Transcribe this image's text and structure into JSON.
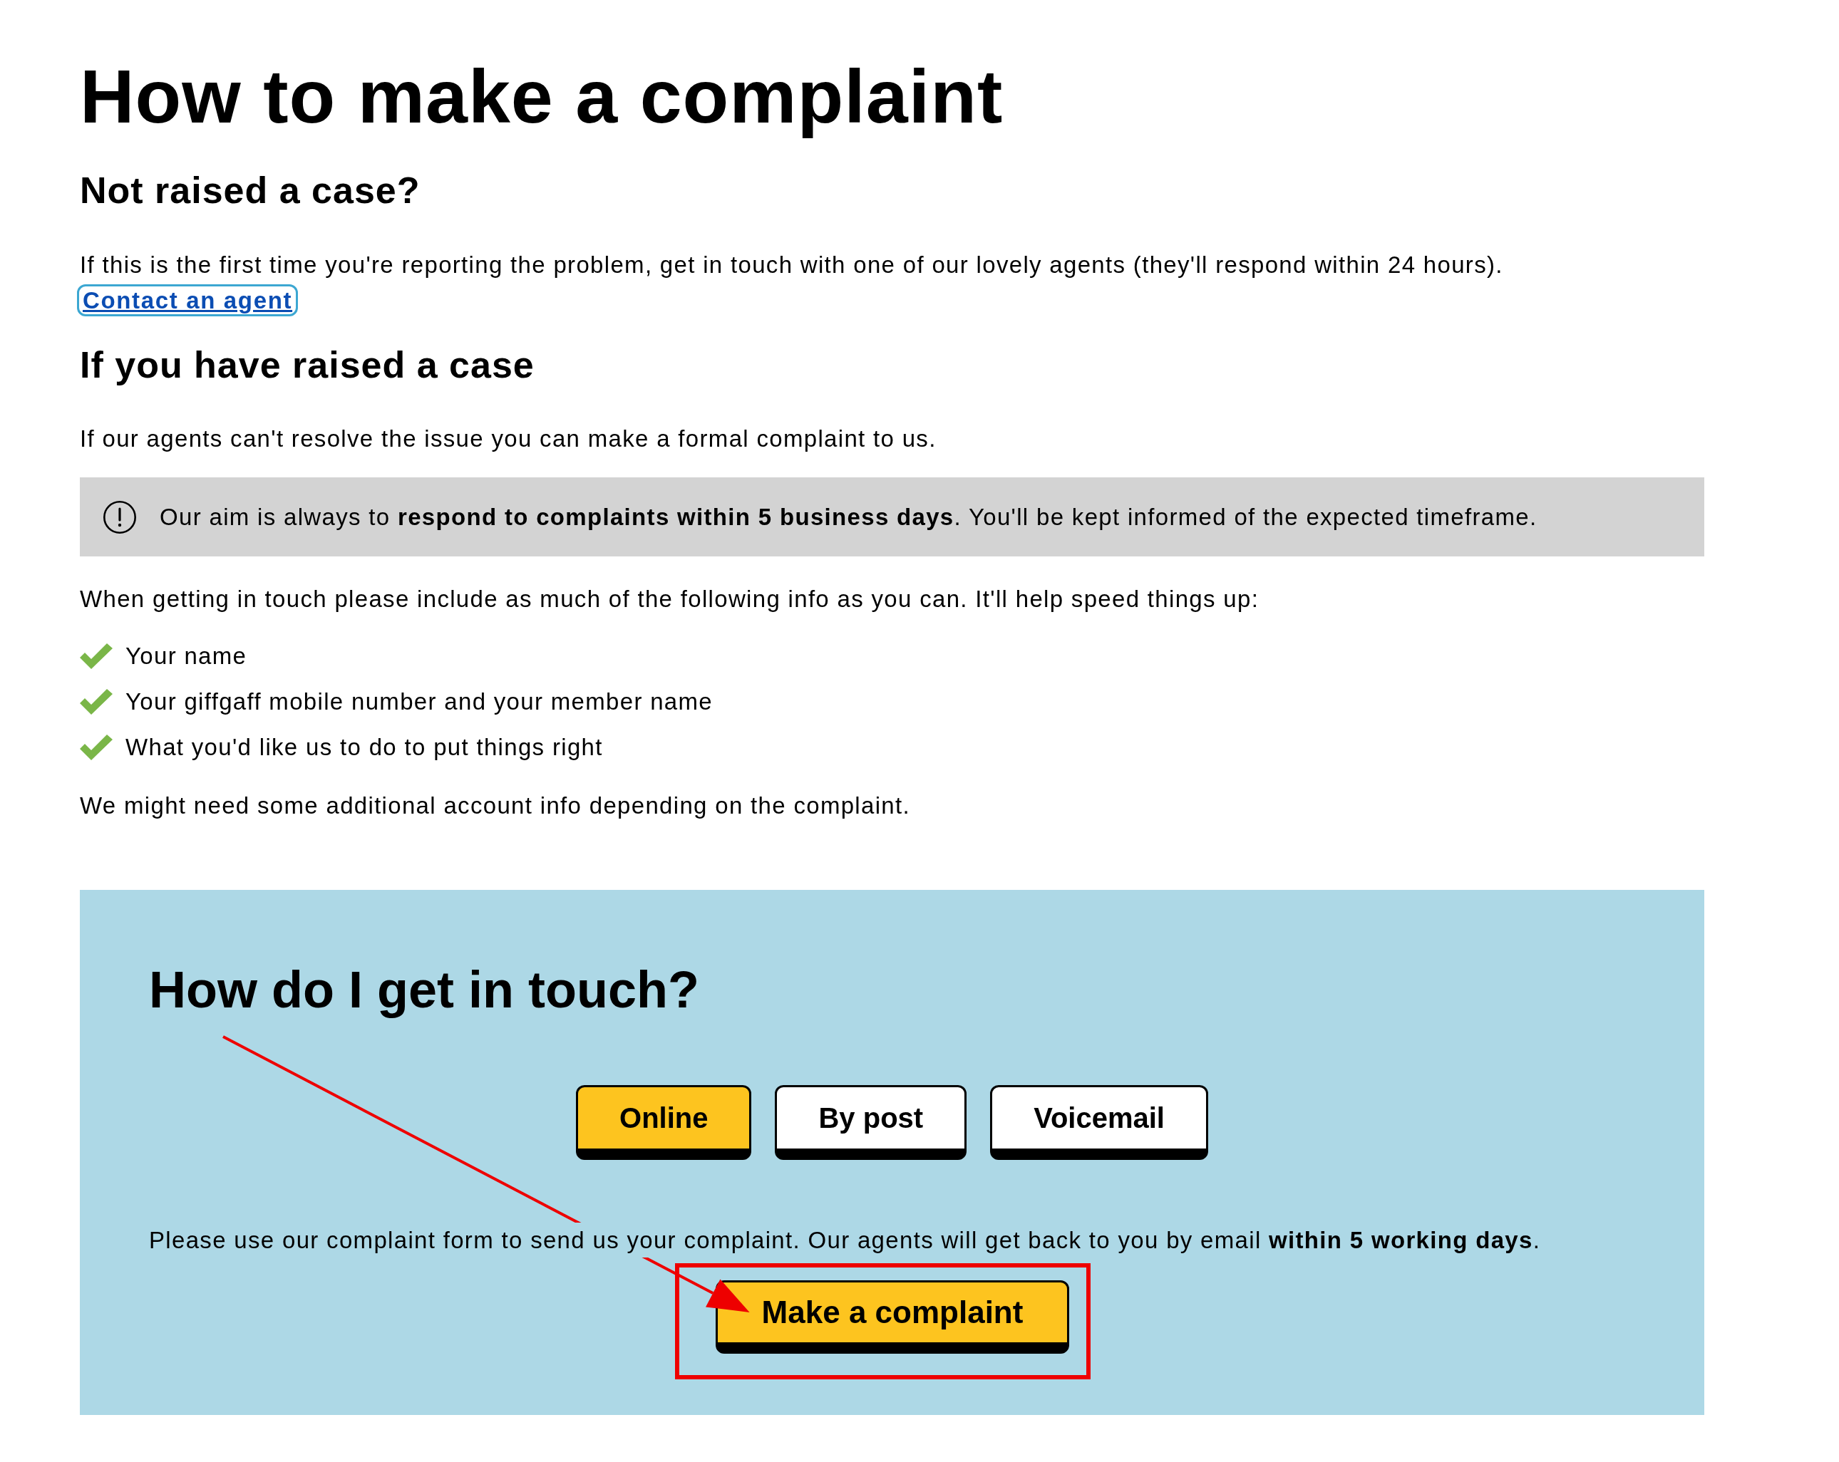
{
  "page_title": "How to make a complaint",
  "sections": [
    {
      "heading": "Not raised a case?",
      "paragraph": "If this is the first time you're reporting the problem, get in touch with one of our lovely agents (they'll respond within 24 hours).",
      "link": {
        "label": "Contact an agent",
        "focused": true
      }
    },
    {
      "heading": "If you have raised a case",
      "paragraph": "If our agents can't resolve the issue you can make a formal complaint to us.",
      "notice": "Our aim is always to **respond to complaints within 5 business days**. You'll be kept informed of the expected timeframe.",
      "intro": "When getting in touch please include as much of the following info as you can. It'll help speed things up:",
      "checklist": [
        "Your name",
        "Your giffgaff mobile number and your member name",
        "What you'd like us to do to put things right"
      ],
      "footnote": "We might need some additional account info depending on the complaint."
    }
  ],
  "contact_panel": {
    "heading": "How do I get in touch?",
    "tabs": [
      {
        "label": "Online",
        "selected": true
      },
      {
        "label": "By post",
        "selected": false
      },
      {
        "label": "Voicemail",
        "selected": false
      }
    ],
    "text": "Please use our complaint form to send us your complaint. Our agents will get back to you by email **within 5 working days**.",
    "button": "Make a complaint"
  },
  "annotations": {
    "arrow": true,
    "frame": true
  }
}
